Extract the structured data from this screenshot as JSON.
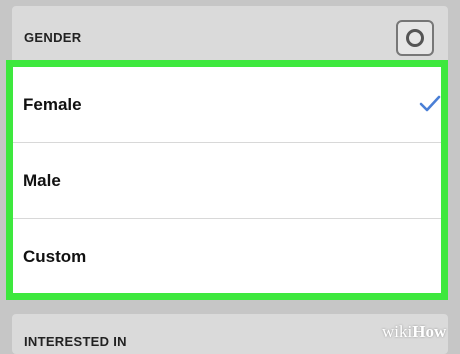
{
  "gender_section": {
    "title": "GENDER"
  },
  "options": [
    {
      "label": "Female",
      "selected": true
    },
    {
      "label": "Male",
      "selected": false
    },
    {
      "label": "Custom",
      "selected": false
    }
  ],
  "interested_section": {
    "title": "INTERESTED IN"
  },
  "watermark": {
    "prefix": "wiki",
    "suffix": "How"
  },
  "colors": {
    "highlight": "#3ee83e",
    "check": "#4a7fd6",
    "background": "#c6c6c6"
  },
  "icons": {
    "toggle": "radio-ring-icon",
    "selected": "checkmark-icon"
  }
}
